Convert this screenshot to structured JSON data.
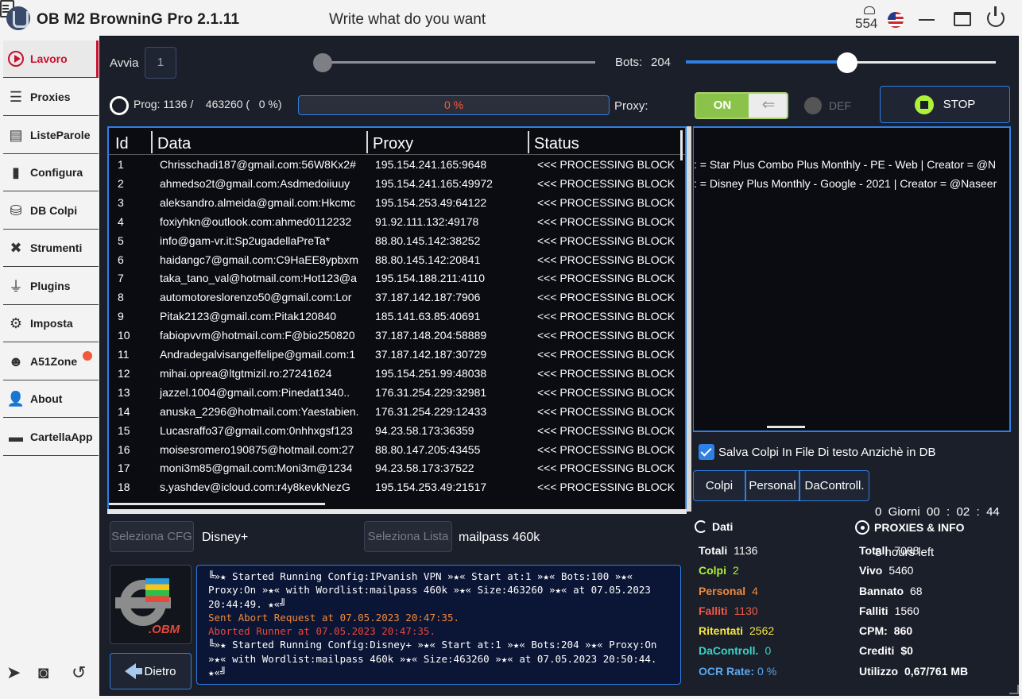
{
  "title_bar": {
    "app_title": "OB M2 BrowninG Pro  2.1.11",
    "hint": "Write what do you want",
    "counter": "554"
  },
  "sidebar": {
    "items": [
      {
        "label": "Lavoro",
        "icon": "play-icon"
      },
      {
        "label": "Proxies",
        "icon": "server-icon"
      },
      {
        "label": "ListeParole",
        "icon": "list-icon"
      },
      {
        "label": "Configura",
        "icon": "book-icon"
      },
      {
        "label": "DB Colpi",
        "icon": "database-icon"
      },
      {
        "label": "Strumenti",
        "icon": "tools-icon"
      },
      {
        "label": "Plugins",
        "icon": "plug-icon"
      },
      {
        "label": "Imposta",
        "icon": "gear-icon"
      },
      {
        "label": "A51Zone",
        "icon": "alien-icon"
      },
      {
        "label": "About",
        "icon": "user-question-icon"
      },
      {
        "label": "CartellaApp",
        "icon": "folder-icon"
      }
    ]
  },
  "controls": {
    "avvia_label": "Avvia",
    "avvia_value": "1",
    "bots_label": "Bots:",
    "bots_value": "204",
    "bots_level": 0.52,
    "avvia_level": 0.0,
    "progress_text": "Prog: 1136 /    463260 (   0 %)",
    "progress_bar_text": "0 %",
    "progress_value": 0,
    "proxy_label": "Proxy:",
    "proxy_toggle_on": "ON",
    "def_label": "DEF",
    "stop_label": "STOP"
  },
  "table": {
    "columns": [
      "Id",
      "Data",
      "Proxy",
      "Status"
    ],
    "rows": [
      [
        "1",
        "Chrisschadi187@gmail.com:56W8Kx2#",
        "195.154.241.165:9648",
        "<<< PROCESSING BLOCK:"
      ],
      [
        "2",
        "ahmedso2t@gmail.com:Asdmedoiiuuy",
        "195.154.241.165:49972",
        "<<< PROCESSING BLOCK:"
      ],
      [
        "3",
        "aleksandro.almeida@gmail.com:Hkcmc",
        "195.154.253.49:64122",
        "<<< PROCESSING BLOCK:"
      ],
      [
        "4",
        "foxiyhkn@outlook.com:ahmed0112232",
        "91.92.111.132:49178",
        "<<< PROCESSING BLOCK:"
      ],
      [
        "5",
        "info@gam-vr.it:Sp2ugadellaPreTa*",
        "88.80.145.142:38252",
        "<<< PROCESSING BLOCK:"
      ],
      [
        "6",
        "haidangc7@gmail.com:C9HaEE8ypbxm",
        "88.80.145.142:20841",
        "<<< PROCESSING BLOCK:"
      ],
      [
        "7",
        "taka_tano_val@hotmail.com:Hot123@a",
        "195.154.188.211:4110",
        "<<< PROCESSING BLOCK:"
      ],
      [
        "8",
        "automotoreslorenzo50@gmail.com:Lor",
        "37.187.142.187:7906",
        "<<< PROCESSING BLOCK:"
      ],
      [
        "9",
        "Pitak2123@gmail.com:Pitak120840",
        "185.141.63.85:40691",
        "<<< PROCESSING BLOCK:"
      ],
      [
        "10",
        "fabiopvvm@hotmail.com:F@bio250820",
        "37.187.148.204:58889",
        "<<< PROCESSING BLOCK:"
      ],
      [
        "11",
        "Andradegalvisangelfelipe@gmail.com:1",
        "37.187.142.187:30729",
        "<<< PROCESSING BLOCK:"
      ],
      [
        "12",
        "mihai.oprea@ltgtmizil.ro:27241624",
        "195.154.251.99:48038",
        "<<< PROCESSING BLOCK:"
      ],
      [
        "13",
        "jazzel.1004@gmail.com:Pinedat1340..",
        "176.31.254.229:32981",
        "<<< PROCESSING BLOCK:"
      ],
      [
        "14",
        "anuska_2296@hotmail.com:Yaestabien.",
        "176.31.254.229:12433",
        "<<< PROCESSING BLOCK:"
      ],
      [
        "15",
        "Lucasraffo37@gmail.com:0nhhxgsf123",
        "94.23.58.173:36359",
        "<<< PROCESSING BLOCK:"
      ],
      [
        "16",
        "moisesromero190875@hotmail.com:27",
        "88.80.147.205:43455",
        "<<< PROCESSING BLOCK:"
      ],
      [
        "17",
        "moni3m85@gmail.com:Moni3m@1234",
        "94.23.58.173:37522",
        "<<< PROCESSING BLOCK:"
      ],
      [
        "18",
        "s.yashdev@icloud.com:r4y8kevkNezG",
        "195.154.253.49:21517",
        "<<< PROCESSING BLOCK:"
      ]
    ]
  },
  "hits_panel": {
    "lines": [
      ": = Star Plus Combo Plus Monthly - PE - Web | Creator = @N",
      ": = Disney Plus Monthly - Google - 2021 | Creator = @Naseer"
    ]
  },
  "save_option": {
    "label": "Salva Colpi In File Di testo Anzichè in DB",
    "checked": true
  },
  "tabs": {
    "colpi": "Colpi",
    "personal": "Personal",
    "dacontroll": "DaControll."
  },
  "timer": {
    "line1": "0  Giorni  00  :  02  :  44",
    "line2": "8 hours left"
  },
  "selectors": {
    "cfg_button": "Seleziona CFG",
    "cfg_value": "Disney+",
    "lista_button": "Seleziona Lista",
    "lista_value": "mailpass 460k"
  },
  "logo_text": ".OBM",
  "back_button": "Dietro",
  "log": [
    {
      "text": "╚»★ Started Running Config:IPvanish VPN »★« Start at:1 »★« Bots:100 »★« Proxy:On »★« with Wordlist:mailpass 460k »★« Size:463260 »★« at 07.05.2023 20:44:49. ★«╝",
      "style": "w"
    },
    {
      "text": "Sent Abort Request at 07.05.2023 20:47:35.",
      "style": "o"
    },
    {
      "text": "Aborted Runner at 07.05.2023 20:47:35.",
      "style": "r"
    },
    {
      "text": "╚»★ Started Running Config:Disney+ »★« Start at:1 »★« Bots:204 »★« Proxy:On »★« with Wordlist:mailpass 460k »★« Size:463260 »★« at 07.05.2023 20:50:44. ★«╝",
      "style": "w"
    }
  ],
  "dati": {
    "title": "Dati",
    "totali_label": "Totali",
    "totali_value": "1136",
    "colpi_label": "Colpi",
    "colpi_value": "2",
    "personal_label": "Personal",
    "personal_value": "4",
    "falliti_label": "Falliti",
    "falliti_value": "1130",
    "ritentati_label": "Ritentati",
    "ritentati_value": "2562",
    "dacontroll_label": "DaControll.",
    "dacontroll_value": "0",
    "ocr_label": "OCR Rate:",
    "ocr_value": "0  %",
    "colors": {
      "colpi": "#aef13a",
      "personal": "#f08a3c",
      "falliti": "#ef5a4a",
      "ritentati": "#f5e642",
      "dacontroll": "#3ad3c8",
      "ocr": "#5aa8f0"
    }
  },
  "proxies_info": {
    "title": "PROXIES & INFO",
    "totali_label": "Totali",
    "totali_value": "7088",
    "vivo_label": "Vivo",
    "vivo_value": "5460",
    "bannato_label": "Bannato",
    "bannato_value": "68",
    "falliti_label": "Falliti",
    "falliti_value": "1560",
    "cpm_label": "CPM:",
    "cpm_value": "860",
    "crediti_label": "Crediti",
    "crediti_value": "$0",
    "utilizzo_label": "Utilizzo",
    "utilizzo_value": "0,67/761 MB"
  }
}
